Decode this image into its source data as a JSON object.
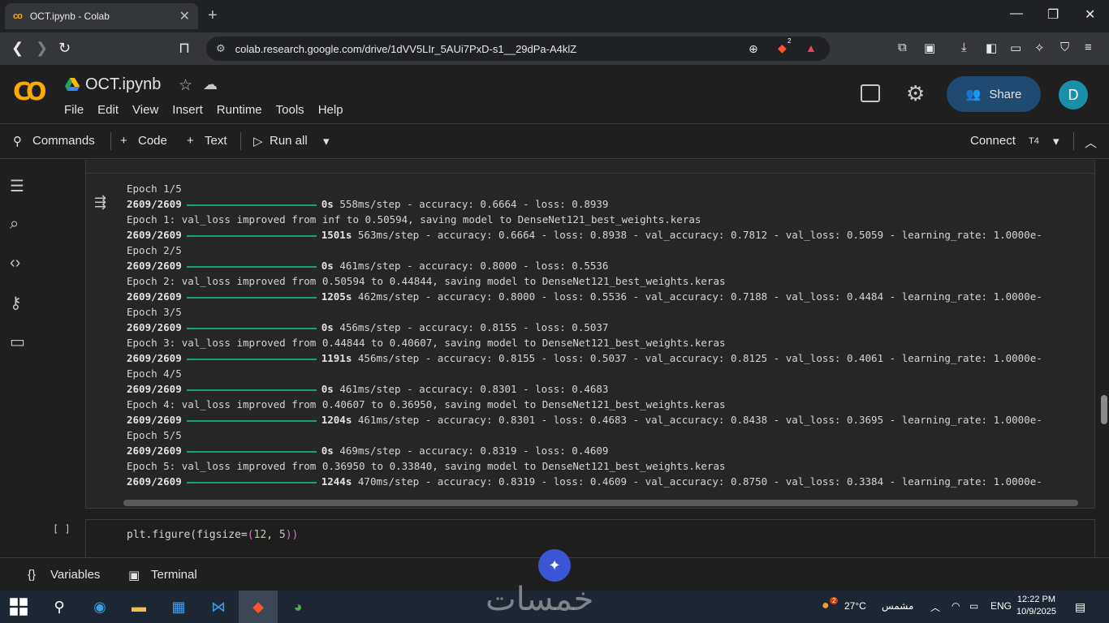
{
  "browser": {
    "tab_title": "OCT.ipynb - Colab",
    "tab_logo": "co",
    "url": "colab.research.google.com/drive/1dVV5LIr_5AUi7PxD-s1__29dPa-A4klZ",
    "brave_badge": "2"
  },
  "header": {
    "notebook_title": "OCT.ipynb",
    "menu": [
      "File",
      "Edit",
      "View",
      "Insert",
      "Runtime",
      "Tools",
      "Help"
    ],
    "share_label": "Share",
    "avatar_letter": "D"
  },
  "toolbar": {
    "commands": "Commands",
    "code": "Code",
    "text": "Text",
    "run_all": "Run all",
    "connect": "Connect",
    "runtime": "T4"
  },
  "output": {
    "lines": [
      {
        "type": "plain",
        "text": "Epoch 1/5"
      },
      {
        "type": "bar",
        "step": "2609/2609",
        "time": "0s",
        "rest": "558ms/step - accuracy: 0.6664 - loss: 0.8939"
      },
      {
        "type": "plain",
        "text": "Epoch 1: val_loss improved from inf to 0.50594, saving model to DenseNet121_best_weights.keras"
      },
      {
        "type": "bar",
        "step": "2609/2609",
        "time": "1501s",
        "rest": "563ms/step - accuracy: 0.6664 - loss: 0.8938 - val_accuracy: 0.7812 - val_loss: 0.5059 - learning_rate: 1.0000e-"
      },
      {
        "type": "plain",
        "text": "Epoch 2/5"
      },
      {
        "type": "bar",
        "step": "2609/2609",
        "time": "0s",
        "rest": "461ms/step - accuracy: 0.8000 - loss: 0.5536"
      },
      {
        "type": "plain",
        "text": "Epoch 2: val_loss improved from 0.50594 to 0.44844, saving model to DenseNet121_best_weights.keras"
      },
      {
        "type": "bar",
        "step": "2609/2609",
        "time": "1205s",
        "rest": "462ms/step - accuracy: 0.8000 - loss: 0.5536 - val_accuracy: 0.7188 - val_loss: 0.4484 - learning_rate: 1.0000e-"
      },
      {
        "type": "plain",
        "text": "Epoch 3/5"
      },
      {
        "type": "bar",
        "step": "2609/2609",
        "time": "0s",
        "rest": "456ms/step - accuracy: 0.8155 - loss: 0.5037"
      },
      {
        "type": "plain",
        "text": "Epoch 3: val_loss improved from 0.44844 to 0.40607, saving model to DenseNet121_best_weights.keras"
      },
      {
        "type": "bar",
        "step": "2609/2609",
        "time": "1191s",
        "rest": "456ms/step - accuracy: 0.8155 - loss: 0.5037 - val_accuracy: 0.8125 - val_loss: 0.4061 - learning_rate: 1.0000e-"
      },
      {
        "type": "plain",
        "text": "Epoch 4/5"
      },
      {
        "type": "bar",
        "step": "2609/2609",
        "time": "0s",
        "rest": "461ms/step - accuracy: 0.8301 - loss: 0.4683"
      },
      {
        "type": "plain",
        "text": "Epoch 4: val_loss improved from 0.40607 to 0.36950, saving model to DenseNet121_best_weights.keras"
      },
      {
        "type": "bar",
        "step": "2609/2609",
        "time": "1204s",
        "rest": "461ms/step - accuracy: 0.8301 - loss: 0.4683 - val_accuracy: 0.8438 - val_loss: 0.3695 - learning_rate: 1.0000e-"
      },
      {
        "type": "plain",
        "text": "Epoch 5/5"
      },
      {
        "type": "bar",
        "step": "2609/2609",
        "time": "0s",
        "rest": "469ms/step - accuracy: 0.8319 - loss: 0.4609"
      },
      {
        "type": "plain",
        "text": "Epoch 5: val_loss improved from 0.36950 to 0.33840, saving model to DenseNet121_best_weights.keras"
      },
      {
        "type": "bar",
        "step": "2609/2609",
        "time": "1244s",
        "rest": "470ms/step - accuracy: 0.8319 - loss: 0.4609 - val_accuracy: 0.8750 - val_loss: 0.3384 - learning_rate: 1.0000e-"
      }
    ]
  },
  "next_cell": {
    "bracket": "[ ]",
    "code_prefix": "plt.figure(figsize=",
    "code_open": "(",
    "code_n1": "12",
    "code_sep": ", ",
    "code_n2": "5",
    "code_close": "))"
  },
  "bottom": {
    "variables": "Variables",
    "terminal": "Terminal"
  },
  "taskbar": {
    "weather_badge": "2",
    "temperature": "27°C",
    "weather_text": "مشمس",
    "language": "ENG",
    "time": "12:22 PM",
    "date": "10/9/2025",
    "watermark": "خمسات"
  },
  "colors": {
    "accent_orange": "#f9ab00",
    "share_bg": "#1f4b72",
    "progress_green": "#1aa179",
    "avatar_bg": "#1a8fa8"
  }
}
